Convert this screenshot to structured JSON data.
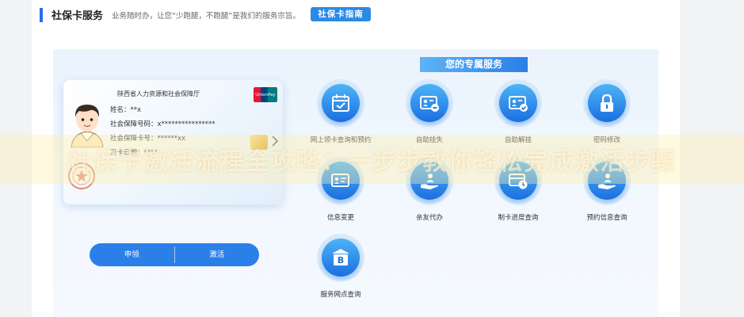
{
  "header": {
    "title": "社保卡服务",
    "subtitle": "业务随时办，让您“少跑腿，不跑腿”是我们的服务宗旨。",
    "guide_button": "社保卡指南"
  },
  "services_title": "您的专属服务",
  "card": {
    "issuer": "陕西省人力资源和社会保障厅",
    "name_label": "姓名：",
    "name_value": "**x",
    "ss_number_label": "社会保障号码：",
    "ss_number_value": "x****************",
    "card_number_label": "社会保障卡号：",
    "card_number_value": "******xx",
    "issue_date_label": "发卡日期：",
    "issue_date_value": "****"
  },
  "buttons": {
    "apply": "申领",
    "activate": "激活"
  },
  "services": [
    {
      "label": "网上领卡查询和预约",
      "icon": "calendar-check-icon"
    },
    {
      "label": "自助挂失",
      "icon": "id-card-minus-icon"
    },
    {
      "label": "自助解挂",
      "icon": "id-card-check-icon"
    },
    {
      "label": "密码修改",
      "icon": "lock-icon"
    },
    {
      "label": "信息变更",
      "icon": "id-card-edit-icon"
    },
    {
      "label": "亲友代办",
      "icon": "hand-person-icon"
    },
    {
      "label": "制卡进度查询",
      "icon": "card-clock-icon"
    },
    {
      "label": "预约信息查询",
      "icon": "hand-person-icon"
    },
    {
      "label": "服务网点查询",
      "icon": "bank-icon"
    }
  ],
  "watermark": "社保卡激活流程全攻略：一步步教你轻松完成激活步骤",
  "colors": {
    "accent": "#2b7fe6",
    "icon_gradient_top": "#4db4f7",
    "icon_gradient_bottom": "#1b6fe0",
    "panel_bg": "#eaf3fd"
  }
}
